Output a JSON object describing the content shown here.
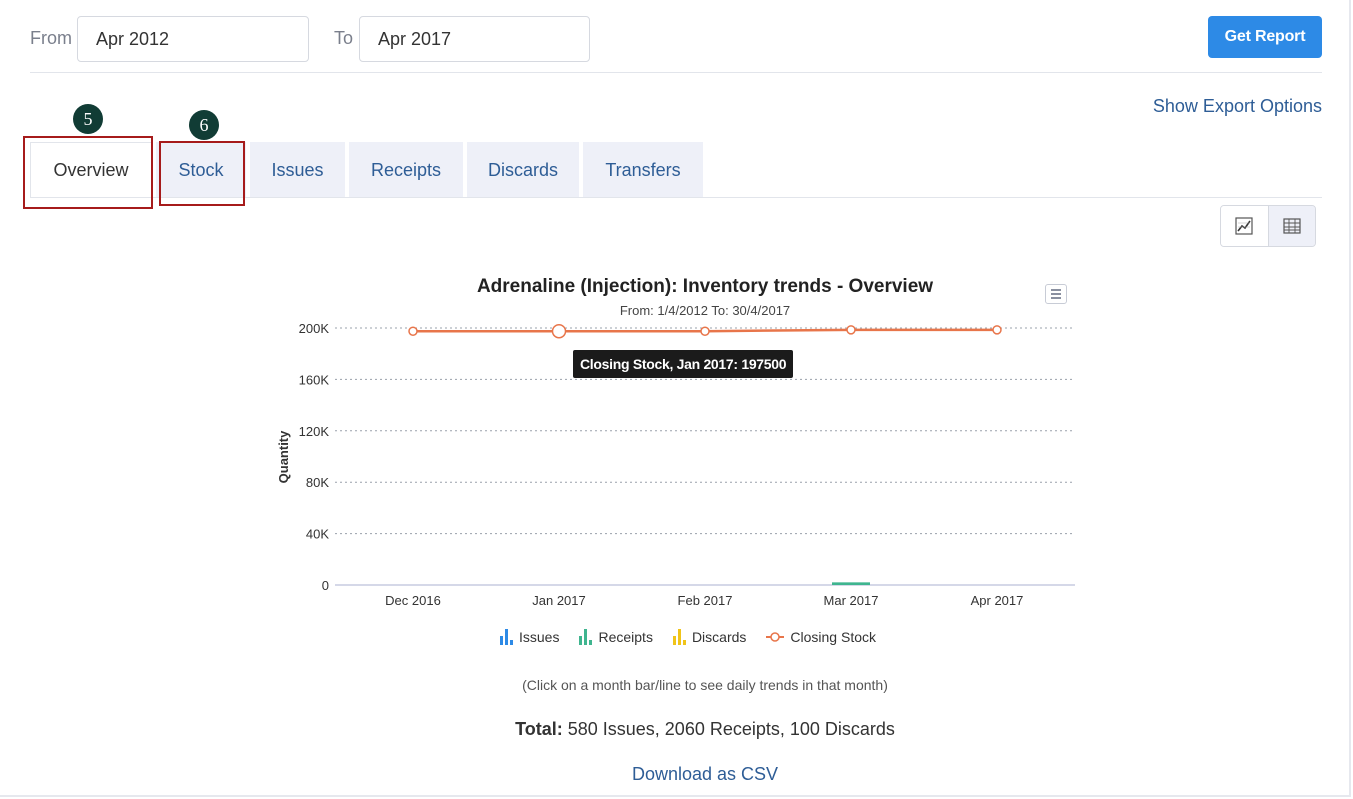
{
  "filters": {
    "from_label": "From",
    "from_value": "Apr 2012",
    "to_label": "To",
    "to_value": "Apr 2017",
    "get_report": "Get Report"
  },
  "export_options": "Show Export Options",
  "tabs": [
    {
      "label": "Overview",
      "active": true
    },
    {
      "label": "Stock",
      "active": false
    },
    {
      "label": "Issues",
      "active": false
    },
    {
      "label": "Receipts",
      "active": false
    },
    {
      "label": "Discards",
      "active": false
    },
    {
      "label": "Transfers",
      "active": false
    }
  ],
  "annotations": {
    "overview_marker": "5",
    "stock_marker": "6",
    "color": "#a61b1b"
  },
  "view_toggle": {
    "chart_icon": "line-chart-icon",
    "table_icon": "table-grid-icon"
  },
  "chart": {
    "title": "Adrenaline (Injection): Inventory trends - Overview",
    "subtitle": "From: 1/4/2012 To: 30/4/2017",
    "tooltip": "Closing Stock, Jan 2017: 197500"
  },
  "chart_data": {
    "type": "line",
    "categories": [
      "Dec 2016",
      "Jan 2017",
      "Feb 2017",
      "Mar 2017",
      "Apr 2017"
    ],
    "ylabel": "Quantity",
    "ylim": [
      0,
      200000
    ],
    "yticks": [
      0,
      40000,
      80000,
      120000,
      160000,
      200000
    ],
    "ytick_labels": [
      "0",
      "40K",
      "80K",
      "120K",
      "160K",
      "200K"
    ],
    "grid": true,
    "legend": "bottom-center",
    "series": [
      {
        "name": "Issues",
        "type": "bar",
        "color": "#2d8ae6",
        "values": [
          0,
          0,
          0,
          0,
          0
        ]
      },
      {
        "name": "Receipts",
        "type": "bar",
        "color": "#3fb58f",
        "values": [
          0,
          0,
          0,
          2060,
          0
        ]
      },
      {
        "name": "Discards",
        "type": "bar",
        "color": "#f0c419",
        "values": [
          0,
          0,
          0,
          0,
          0
        ]
      },
      {
        "name": "Closing Stock",
        "type": "line",
        "color": "#e8754a",
        "values": [
          197500,
          197500,
          197500,
          198560,
          198560
        ]
      }
    ]
  },
  "legend_items": [
    "Issues",
    "Receipts",
    "Discards",
    "Closing Stock"
  ],
  "hint": "(Click on a month bar/line to see daily trends in that month)",
  "totals": {
    "label": "Total:",
    "text": "580 Issues, 2060 Receipts, 100 Discards"
  },
  "download_csv": "Download as CSV"
}
